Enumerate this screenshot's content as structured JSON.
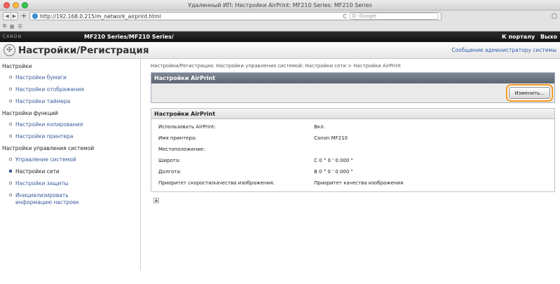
{
  "browser": {
    "window_title": "Удаленный ИП: Настройки AirPrint: MF210 Series: MF210 Series",
    "url": "http://192.168.0.215/m_network_airprint.html",
    "reload_glyph": "C",
    "search_placeholder": "Q- Google"
  },
  "header": {
    "brand": "CANON",
    "model": "MF210 Series/MF210 Series/",
    "portal_link": "К порталу",
    "logout_link": "Выхо"
  },
  "titlebar": {
    "title": "Настройки/Регистрация",
    "admin_message": "Сообщение администратору системы"
  },
  "sidebar": {
    "sections": [
      {
        "label": "Настройки",
        "items": [
          {
            "label": "Настройки бумаги",
            "active": false
          },
          {
            "label": "Настройки отображения",
            "active": false
          },
          {
            "label": "Настройки таймера",
            "active": false
          }
        ]
      },
      {
        "label": "Настройки функций",
        "items": [
          {
            "label": "Настройки копирования",
            "active": false
          },
          {
            "label": "Настройки принтера",
            "active": false
          }
        ]
      },
      {
        "label": "Настройки управления системой",
        "items": [
          {
            "label": "Управление системой",
            "active": false
          },
          {
            "label": "Настройки сети",
            "active": true
          },
          {
            "label": "Настройки защиты",
            "active": false
          },
          {
            "label": "Инициализировать информацию настроек",
            "active": false
          }
        ]
      }
    ]
  },
  "main": {
    "breadcrumb": "Настройки/Регистрация: Настройки управления системой: Настройки сети > Настройки AirPrint",
    "panel_title": "Настройки AirPrint",
    "edit_button": "Изменить...",
    "details_title": "Настройки AirPrint",
    "rows": [
      {
        "key": "Использовать AirPrint:",
        "value": "Вкл."
      },
      {
        "key": "Имя принтера:",
        "value": "Canon MF210"
      },
      {
        "key": "Местоположение:",
        "value": ""
      },
      {
        "key": "Широта:",
        "value": "С 0 ° 0 ' 0.000 \""
      },
      {
        "key": "Долгота:",
        "value": "В 0 ° 0 ' 0.000 \""
      },
      {
        "key": "Приоритет скорости/качества изображения:",
        "value": "Приоритет качества изображения"
      }
    ]
  }
}
